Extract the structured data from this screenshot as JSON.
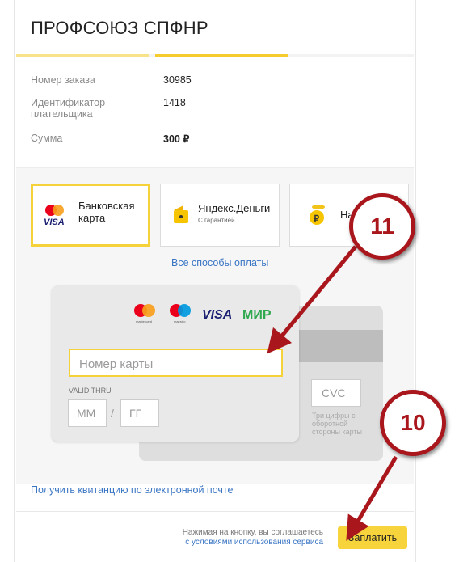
{
  "header": {
    "title": "ПРОФСОЮЗ СПФНР"
  },
  "order": [
    {
      "label": "Номер заказа",
      "value": "30985"
    },
    {
      "label": "Идентификатор плательщика",
      "value": "1418"
    },
    {
      "label": "Сумма",
      "value": "300 ₽"
    }
  ],
  "methods": [
    {
      "line1": "Банковская",
      "line2": "карта",
      "selected": true
    },
    {
      "line1": "Яндекс.Деньги",
      "line2": "С гарантией",
      "selected": false
    },
    {
      "line1": "Наличные",
      "selected": false
    }
  ],
  "all_methods_link": "Все способы оплаты",
  "card": {
    "brands": [
      "mastercard",
      "maestro",
      "VISA",
      "МИР"
    ],
    "brand_small": {
      "mastercard": "mastercard",
      "maestro": "maestro"
    },
    "number_placeholder": "Номер карты",
    "valid_thru": "VALID THRU",
    "month_placeholder": "ММ",
    "year_placeholder": "ГГ",
    "slash": "/",
    "cvc_placeholder": "CVC",
    "cvc_hint": "Три цифры с оборотной стороны карты"
  },
  "receipt_link": "Получить квитанцию по электронной почте",
  "footer": {
    "agree_text": "Нажимая на кнопку, вы соглашаетесь",
    "agree_link": "с условиями использования сервиса",
    "pay_button": "Заплатить"
  },
  "callouts": [
    {
      "number": "11"
    },
    {
      "number": "10"
    }
  ],
  "colors": {
    "accent_yellow": "#f5d13a",
    "link_blue": "#3a75c4",
    "callout_red": "#a9171d"
  }
}
